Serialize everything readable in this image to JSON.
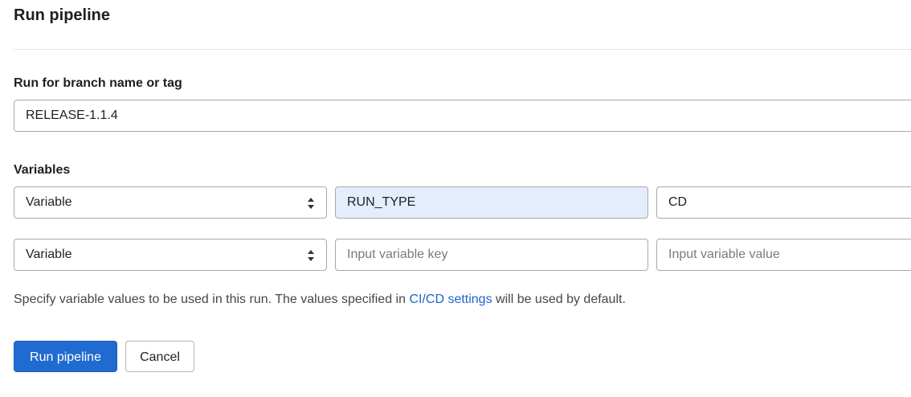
{
  "page": {
    "title": "Run pipeline"
  },
  "branch": {
    "label": "Run for branch name or tag",
    "value": "RELEASE-1.1.4"
  },
  "variables": {
    "label": "Variables",
    "rows": [
      {
        "type": "Variable",
        "key": "RUN_TYPE",
        "value": "CD",
        "key_placeholder": "",
        "value_placeholder": ""
      },
      {
        "type": "Variable",
        "key": "",
        "value": "",
        "key_placeholder": "Input variable key",
        "value_placeholder": "Input variable value"
      }
    ]
  },
  "help": {
    "text_before": "Specify variable values to be used in this run. The values specified in ",
    "link_text": "CI/CD settings",
    "text_after": " will be used by default."
  },
  "actions": {
    "run_label": "Run pipeline",
    "cancel_label": "Cancel"
  },
  "colors": {
    "primary": "#1f6bd1",
    "link": "#1f63c8",
    "filled_key_bg": "#e3edfc"
  },
  "icons": {
    "select_arrows": "sort-arrows-icon"
  }
}
